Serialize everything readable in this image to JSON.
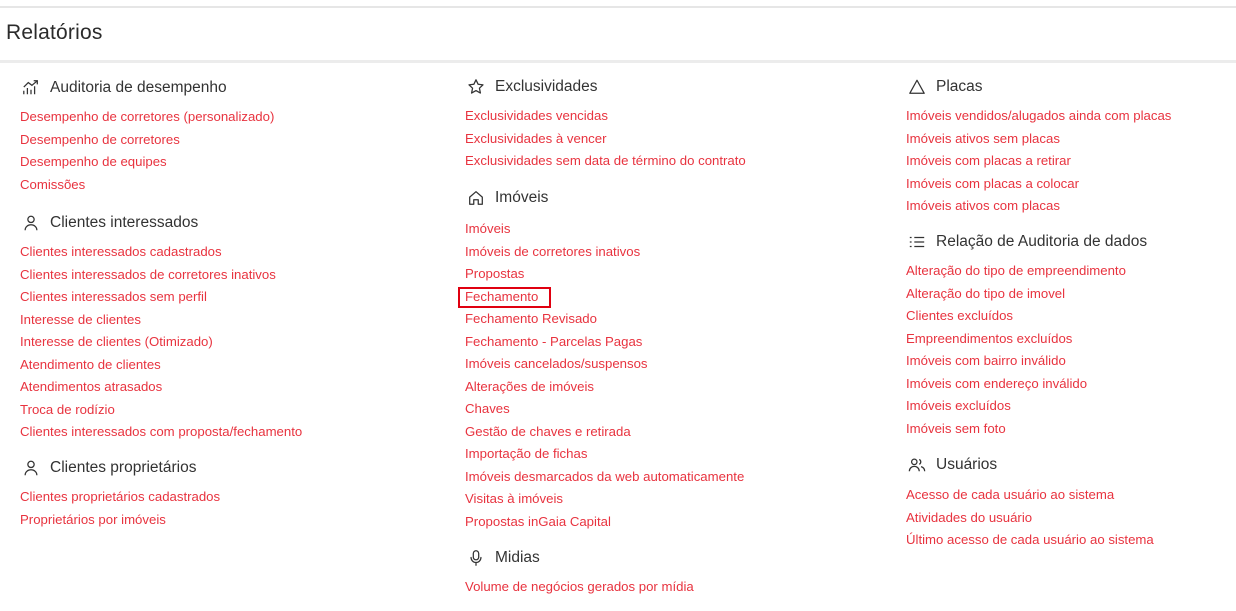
{
  "page_title": "Relatórios",
  "colors": {
    "link": "#e8333f",
    "highlight": "#e00010"
  },
  "col1": {
    "auditoria": {
      "title": "Auditoria de desempenho",
      "icon": "trending-up-chart-icon",
      "links": [
        "Desempenho de corretores (personalizado)",
        "Desempenho de corretores",
        "Desempenho de equipes",
        "Comissões"
      ]
    },
    "clientes_interessados": {
      "title": "Clientes interessados",
      "icon": "user-icon",
      "links": [
        "Clientes interessados cadastrados",
        "Clientes interessados de corretores inativos",
        "Clientes interessados sem perfil",
        "Interesse de clientes",
        "Interesse de clientes (Otimizado)",
        "Atendimento de clientes",
        "Atendimentos atrasados",
        "Troca de rodízio",
        "Clientes interessados com proposta/fechamento"
      ]
    },
    "clientes_proprietarios": {
      "title": "Clientes proprietários",
      "icon": "user-icon",
      "links": [
        "Clientes proprietários cadastrados",
        "Proprietários por imóveis"
      ]
    }
  },
  "col2": {
    "exclusividades": {
      "title": "Exclusividades",
      "icon": "star-icon",
      "links": [
        "Exclusividades vencidas",
        "Exclusividades à vencer",
        "Exclusividades sem data de término do contrato"
      ]
    },
    "imoveis": {
      "title": "Imóveis",
      "icon": "home-icon",
      "links": [
        "Imóveis",
        "Imóveis de corretores inativos",
        "Propostas",
        "Fechamento",
        "Fechamento Revisado",
        "Fechamento - Parcelas Pagas",
        "Imóveis cancelados/suspensos",
        "Alterações de imóveis",
        "Chaves",
        "Gestão de chaves e retirada",
        "Importação de fichas",
        "Imóveis desmarcados da web automaticamente",
        "Visitas à imóveis",
        "Propostas inGaia Capital"
      ]
    },
    "midias": {
      "title": "Midias",
      "icon": "microphone-icon",
      "links": [
        "Volume de negócios gerados por mídia"
      ]
    }
  },
  "col3": {
    "placas": {
      "title": "Placas",
      "icon": "triangle-icon",
      "links": [
        "Imóveis vendidos/alugados ainda com placas",
        "Imóveis ativos sem placas",
        "Imóveis com placas a retirar",
        "Imóveis com placas a colocar",
        "Imóveis ativos com placas"
      ]
    },
    "relacao": {
      "title": "Relação de Auditoria de dados",
      "icon": "list-icon",
      "links": [
        "Alteração do tipo de empreendimento",
        "Alteração do tipo de imovel",
        "Clientes excluídos",
        "Empreendimentos excluídos",
        "Imóveis com bairro inválido",
        "Imóveis com endereço inválido",
        "Imóveis excluídos",
        "Imóveis sem foto"
      ]
    },
    "usuarios": {
      "title": "Usuários",
      "icon": "users-icon",
      "links": [
        "Acesso de cada usuário ao sistema",
        "Atividades do usuário",
        "Último acesso de cada usuário ao sistema"
      ]
    }
  }
}
